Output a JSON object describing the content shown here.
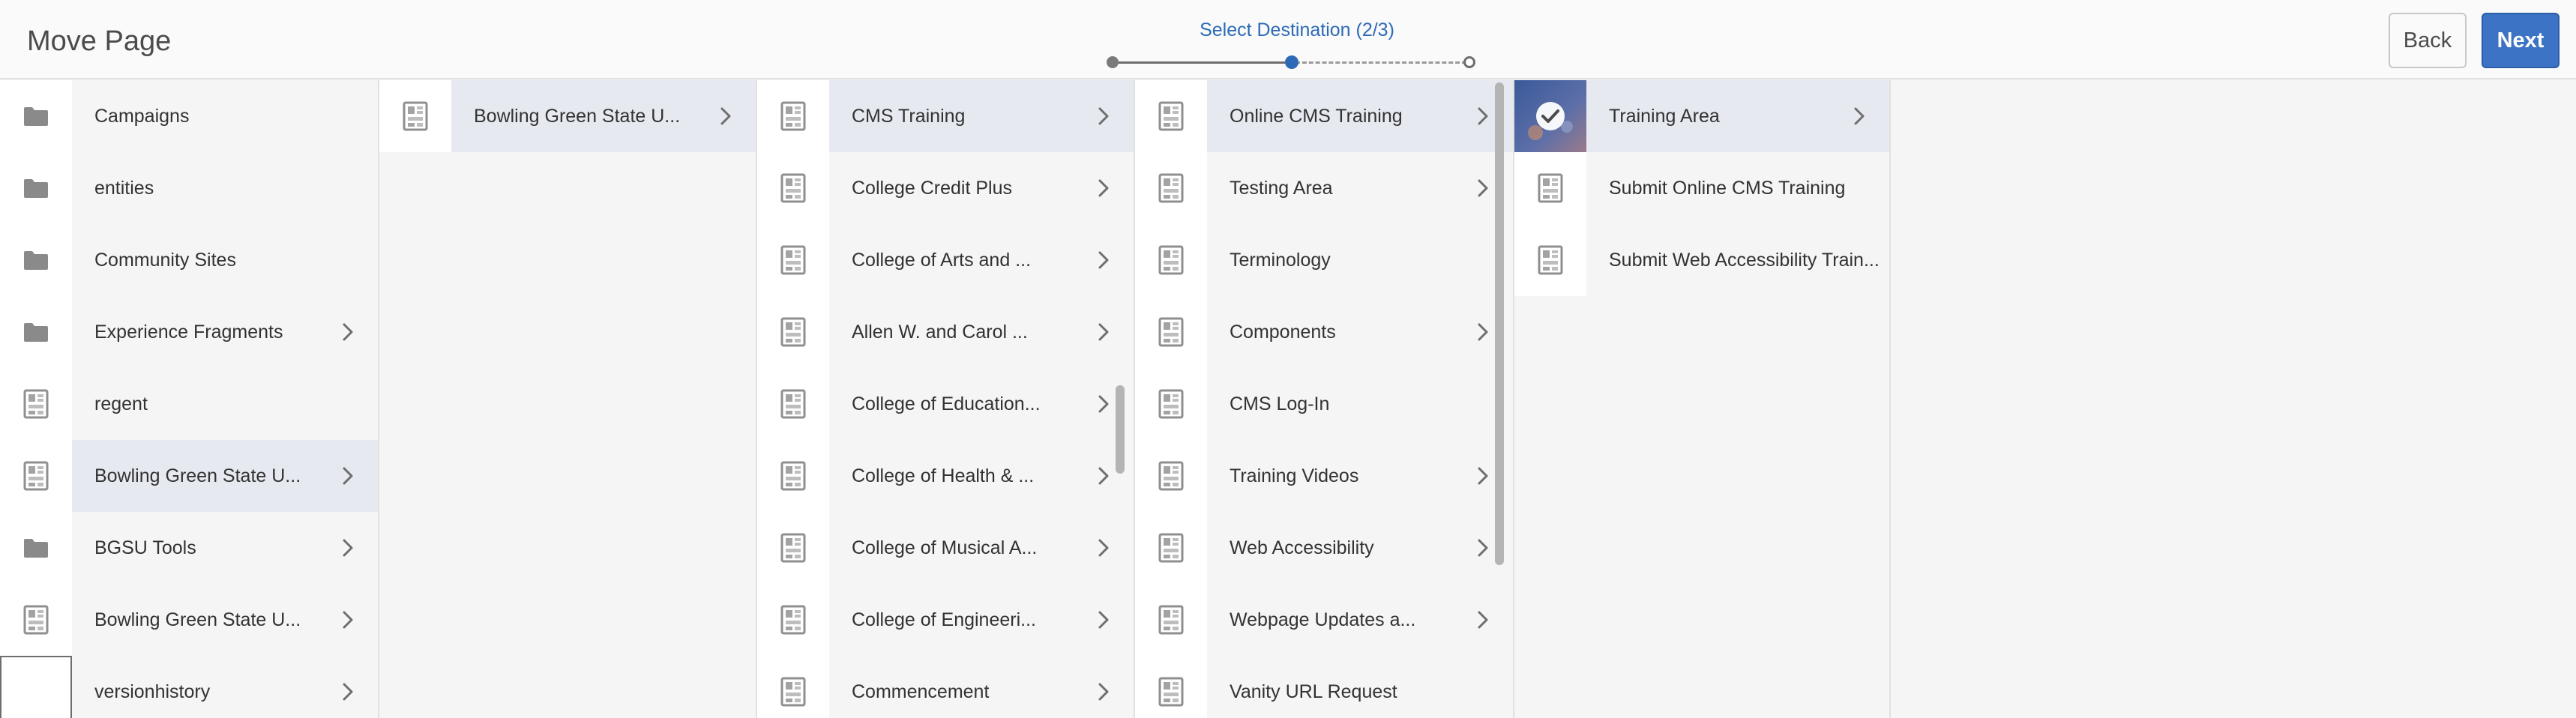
{
  "header": {
    "title": "Move Page",
    "wizard": {
      "step_label": "Select Destination (2/3)",
      "current_step": 2,
      "total_steps": 3
    },
    "back_label": "Back",
    "next_label": "Next"
  },
  "colors": {
    "accent": "#3d73c4",
    "selected_row": "#e6e9f0",
    "panel_bg": "#f5f5f5"
  },
  "columns": [
    {
      "items": [
        {
          "label": "Campaigns",
          "icon": "folder-icon",
          "has_children": false,
          "selected": false
        },
        {
          "label": "entities",
          "icon": "folder-icon",
          "has_children": false,
          "selected": false
        },
        {
          "label": "Community Sites",
          "icon": "folder-icon",
          "has_children": false,
          "selected": false
        },
        {
          "label": "Experience Fragments",
          "icon": "folder-icon",
          "has_children": true,
          "selected": false
        },
        {
          "label": "regent",
          "icon": "page-icon",
          "has_children": false,
          "selected": false
        },
        {
          "label": "Bowling Green State U...",
          "icon": "page-icon",
          "has_children": true,
          "selected": true
        },
        {
          "label": "BGSU Tools",
          "icon": "folder-icon",
          "has_children": true,
          "selected": false
        },
        {
          "label": "Bowling Green State U...",
          "icon": "page-icon",
          "has_children": true,
          "selected": false
        },
        {
          "label": "versionhistory",
          "icon": "blank-thumbnail",
          "has_children": true,
          "selected": false
        }
      ]
    },
    {
      "items": [
        {
          "label": "Bowling Green State U...",
          "icon": "page-icon",
          "has_children": true,
          "selected": true
        }
      ]
    },
    {
      "items": [
        {
          "label": "CMS Training",
          "icon": "page-icon",
          "has_children": true,
          "selected": true
        },
        {
          "label": "College Credit Plus",
          "icon": "page-icon",
          "has_children": true,
          "selected": false
        },
        {
          "label": "College of Arts and ...",
          "icon": "page-icon",
          "has_children": true,
          "selected": false
        },
        {
          "label": "Allen W. and Carol ...",
          "icon": "page-icon",
          "has_children": true,
          "selected": false
        },
        {
          "label": "College of Education...",
          "icon": "page-icon",
          "has_children": true,
          "selected": false
        },
        {
          "label": "College of Health & ...",
          "icon": "page-icon",
          "has_children": true,
          "selected": false
        },
        {
          "label": "College of Musical A...",
          "icon": "page-icon",
          "has_children": true,
          "selected": false
        },
        {
          "label": "College of Engineeri...",
          "icon": "page-icon",
          "has_children": true,
          "selected": false
        },
        {
          "label": "Commencement",
          "icon": "page-icon",
          "has_children": true,
          "selected": false
        }
      ]
    },
    {
      "items": [
        {
          "label": "Online CMS Training",
          "icon": "page-icon",
          "has_children": true,
          "selected": true
        },
        {
          "label": "Testing Area",
          "icon": "page-icon",
          "has_children": true,
          "selected": false
        },
        {
          "label": "Terminology",
          "icon": "page-icon",
          "has_children": false,
          "selected": false
        },
        {
          "label": "Components",
          "icon": "page-icon",
          "has_children": true,
          "selected": false
        },
        {
          "label": "CMS Log-In",
          "icon": "page-icon",
          "has_children": false,
          "selected": false
        },
        {
          "label": "Training Videos",
          "icon": "page-icon",
          "has_children": true,
          "selected": false
        },
        {
          "label": "Web Accessibility",
          "icon": "page-icon",
          "has_children": true,
          "selected": false
        },
        {
          "label": "Webpage Updates a...",
          "icon": "page-icon",
          "has_children": true,
          "selected": false
        },
        {
          "label": "Vanity URL Request",
          "icon": "page-icon",
          "has_children": false,
          "selected": false
        }
      ]
    },
    {
      "items": [
        {
          "label": "Training Area",
          "icon": "checked-thumbnail",
          "has_children": true,
          "selected": true
        },
        {
          "label": "Submit Online CMS Training",
          "icon": "page-icon",
          "has_children": false,
          "selected": false
        },
        {
          "label": "Submit Web Accessibility Train...",
          "icon": "page-icon",
          "has_children": false,
          "selected": false
        }
      ]
    }
  ]
}
